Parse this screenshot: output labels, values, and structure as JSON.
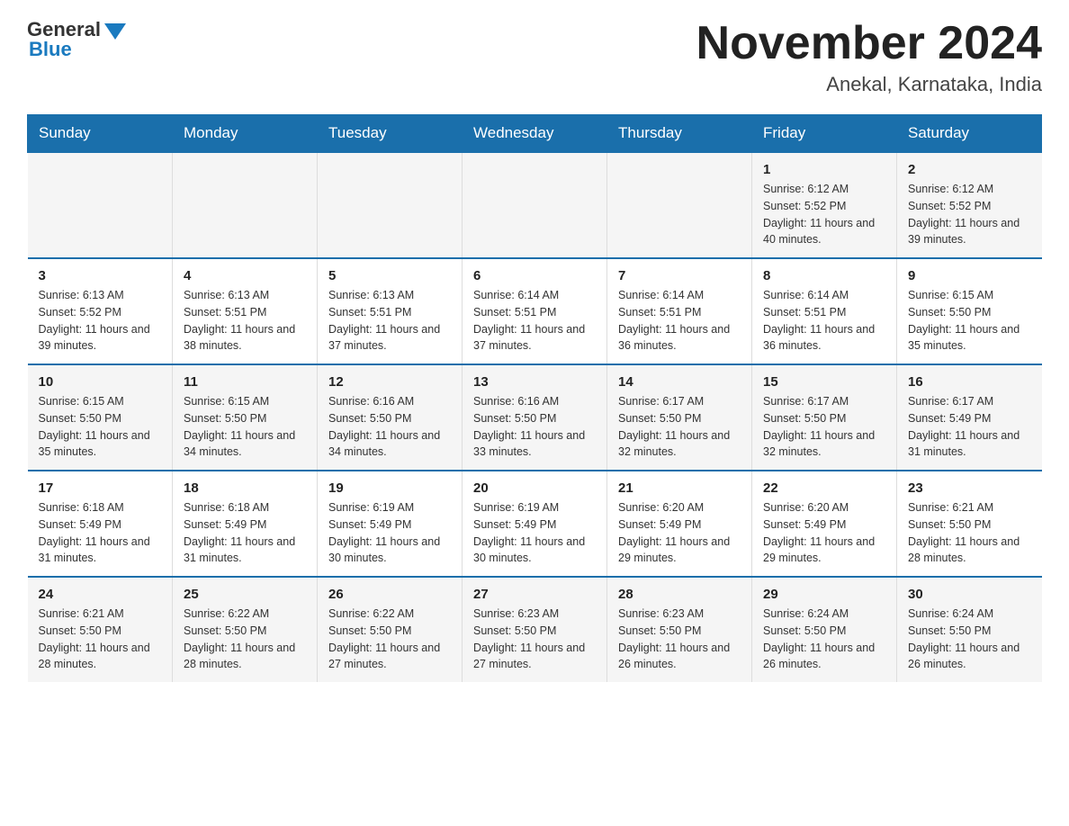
{
  "logo": {
    "general_text": "General",
    "blue_text": "Blue"
  },
  "header": {
    "month_title": "November 2024",
    "location": "Anekal, Karnataka, India"
  },
  "weekdays": [
    "Sunday",
    "Monday",
    "Tuesday",
    "Wednesday",
    "Thursday",
    "Friday",
    "Saturday"
  ],
  "weeks": [
    [
      {
        "day": "",
        "info": ""
      },
      {
        "day": "",
        "info": ""
      },
      {
        "day": "",
        "info": ""
      },
      {
        "day": "",
        "info": ""
      },
      {
        "day": "",
        "info": ""
      },
      {
        "day": "1",
        "info": "Sunrise: 6:12 AM\nSunset: 5:52 PM\nDaylight: 11 hours and 40 minutes."
      },
      {
        "day": "2",
        "info": "Sunrise: 6:12 AM\nSunset: 5:52 PM\nDaylight: 11 hours and 39 minutes."
      }
    ],
    [
      {
        "day": "3",
        "info": "Sunrise: 6:13 AM\nSunset: 5:52 PM\nDaylight: 11 hours and 39 minutes."
      },
      {
        "day": "4",
        "info": "Sunrise: 6:13 AM\nSunset: 5:51 PM\nDaylight: 11 hours and 38 minutes."
      },
      {
        "day": "5",
        "info": "Sunrise: 6:13 AM\nSunset: 5:51 PM\nDaylight: 11 hours and 37 minutes."
      },
      {
        "day": "6",
        "info": "Sunrise: 6:14 AM\nSunset: 5:51 PM\nDaylight: 11 hours and 37 minutes."
      },
      {
        "day": "7",
        "info": "Sunrise: 6:14 AM\nSunset: 5:51 PM\nDaylight: 11 hours and 36 minutes."
      },
      {
        "day": "8",
        "info": "Sunrise: 6:14 AM\nSunset: 5:51 PM\nDaylight: 11 hours and 36 minutes."
      },
      {
        "day": "9",
        "info": "Sunrise: 6:15 AM\nSunset: 5:50 PM\nDaylight: 11 hours and 35 minutes."
      }
    ],
    [
      {
        "day": "10",
        "info": "Sunrise: 6:15 AM\nSunset: 5:50 PM\nDaylight: 11 hours and 35 minutes."
      },
      {
        "day": "11",
        "info": "Sunrise: 6:15 AM\nSunset: 5:50 PM\nDaylight: 11 hours and 34 minutes."
      },
      {
        "day": "12",
        "info": "Sunrise: 6:16 AM\nSunset: 5:50 PM\nDaylight: 11 hours and 34 minutes."
      },
      {
        "day": "13",
        "info": "Sunrise: 6:16 AM\nSunset: 5:50 PM\nDaylight: 11 hours and 33 minutes."
      },
      {
        "day": "14",
        "info": "Sunrise: 6:17 AM\nSunset: 5:50 PM\nDaylight: 11 hours and 32 minutes."
      },
      {
        "day": "15",
        "info": "Sunrise: 6:17 AM\nSunset: 5:50 PM\nDaylight: 11 hours and 32 minutes."
      },
      {
        "day": "16",
        "info": "Sunrise: 6:17 AM\nSunset: 5:49 PM\nDaylight: 11 hours and 31 minutes."
      }
    ],
    [
      {
        "day": "17",
        "info": "Sunrise: 6:18 AM\nSunset: 5:49 PM\nDaylight: 11 hours and 31 minutes."
      },
      {
        "day": "18",
        "info": "Sunrise: 6:18 AM\nSunset: 5:49 PM\nDaylight: 11 hours and 31 minutes."
      },
      {
        "day": "19",
        "info": "Sunrise: 6:19 AM\nSunset: 5:49 PM\nDaylight: 11 hours and 30 minutes."
      },
      {
        "day": "20",
        "info": "Sunrise: 6:19 AM\nSunset: 5:49 PM\nDaylight: 11 hours and 30 minutes."
      },
      {
        "day": "21",
        "info": "Sunrise: 6:20 AM\nSunset: 5:49 PM\nDaylight: 11 hours and 29 minutes."
      },
      {
        "day": "22",
        "info": "Sunrise: 6:20 AM\nSunset: 5:49 PM\nDaylight: 11 hours and 29 minutes."
      },
      {
        "day": "23",
        "info": "Sunrise: 6:21 AM\nSunset: 5:50 PM\nDaylight: 11 hours and 28 minutes."
      }
    ],
    [
      {
        "day": "24",
        "info": "Sunrise: 6:21 AM\nSunset: 5:50 PM\nDaylight: 11 hours and 28 minutes."
      },
      {
        "day": "25",
        "info": "Sunrise: 6:22 AM\nSunset: 5:50 PM\nDaylight: 11 hours and 28 minutes."
      },
      {
        "day": "26",
        "info": "Sunrise: 6:22 AM\nSunset: 5:50 PM\nDaylight: 11 hours and 27 minutes."
      },
      {
        "day": "27",
        "info": "Sunrise: 6:23 AM\nSunset: 5:50 PM\nDaylight: 11 hours and 27 minutes."
      },
      {
        "day": "28",
        "info": "Sunrise: 6:23 AM\nSunset: 5:50 PM\nDaylight: 11 hours and 26 minutes."
      },
      {
        "day": "29",
        "info": "Sunrise: 6:24 AM\nSunset: 5:50 PM\nDaylight: 11 hours and 26 minutes."
      },
      {
        "day": "30",
        "info": "Sunrise: 6:24 AM\nSunset: 5:50 PM\nDaylight: 11 hours and 26 minutes."
      }
    ]
  ]
}
